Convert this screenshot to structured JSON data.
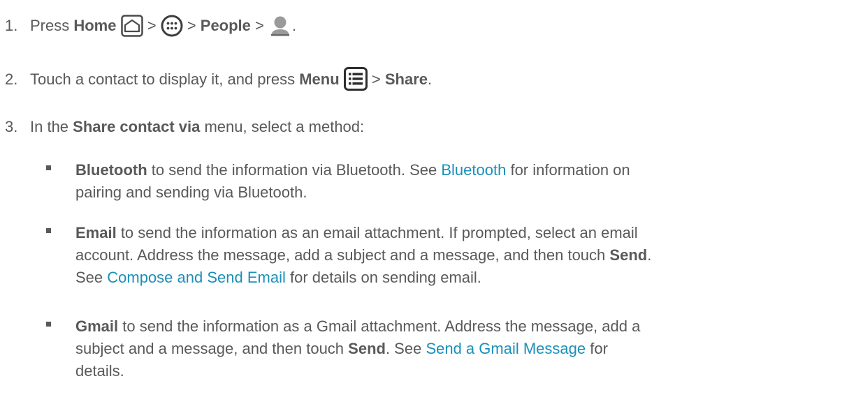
{
  "colors": {
    "text": "#595959",
    "link": "#1a8fb8",
    "icon": "#4a4a4a"
  },
  "steps": [
    {
      "num": "1.",
      "press": "Press ",
      "home": "Home",
      "sep1": " > ",
      "sep2": " > ",
      "people": "People",
      "sep3": " > ",
      "end": ".",
      "icons": [
        "home-icon",
        "apps-icon",
        "person-icon"
      ]
    },
    {
      "num": "2.",
      "text1": "Touch a contact to display it, and press ",
      "menu": "Menu",
      "sep": " > ",
      "share": "Share",
      "end": ".",
      "icons": [
        "menu-icon"
      ]
    },
    {
      "num": "3.",
      "text1": "In the ",
      "bold": "Share contact via",
      "text2": " menu, select a method:"
    }
  ],
  "bullets": [
    {
      "term": "Bluetooth",
      "t1": " to send the information via Bluetooth. See ",
      "link": "Bluetooth",
      "t2": " for information on",
      "t3": "pairing and sending via Bluetooth."
    },
    {
      "term": "Email",
      "t1": " to send the information as an email attachment. If prompted, select an email",
      "t2": "account. Address the message, add a subject and a message, and then touch ",
      "send": "Send",
      "t3": ".",
      "t4": "See ",
      "link": "Compose and Send Email",
      "t5": " for details on sending email."
    },
    {
      "term": "Gmail",
      "t1": " to send the information as a Gmail attachment. Address the message, add a",
      "t2": "subject and a message, and then touch ",
      "send": "Send",
      "t3": ". See ",
      "link": "Send a Gmail Message",
      "t4": " for",
      "t5": "details."
    }
  ]
}
